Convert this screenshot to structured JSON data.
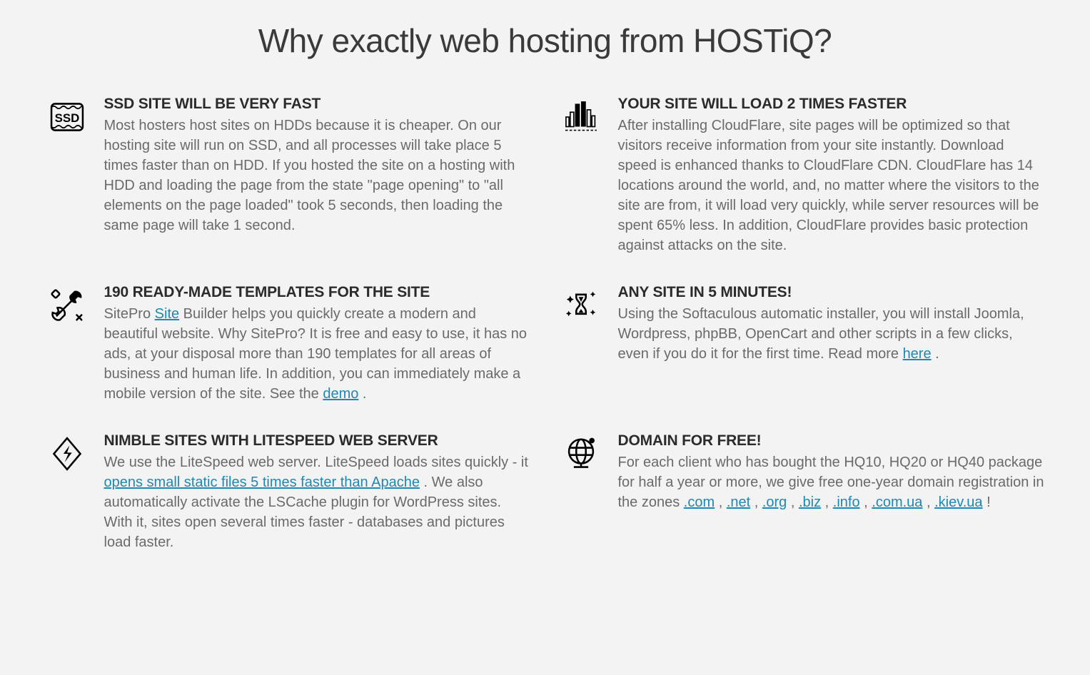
{
  "heading": "Why exactly web hosting from HOSTiQ?",
  "features": {
    "ssd": {
      "title": "SSD SITE WILL BE VERY FAST",
      "desc": "Most hosters host sites on HDDs because it is cheaper. On our hosting site will run on SSD, and all processes will take place 5 times faster than on HDD. If you hosted the site on a hosting with HDD and loading the page from the state \"page opening\" to \"all elements on the page loaded\" took 5 seconds, then loading the same page will take 1 second."
    },
    "cloudflare": {
      "title": "YOUR SITE WILL LOAD 2 TIMES FASTER",
      "desc": "After installing CloudFlare, site pages will be optimized so that visitors receive information from your site instantly. Download speed is enhanced thanks to CloudFlare CDN. CloudFlare has 14 locations around the world, and, no matter where the visitors to the site are from, it will load very quickly, while server resources will be spent 65% less. In addition, CloudFlare provides basic protection against attacks on the site."
    },
    "templates": {
      "title": "190 READY-MADE TEMPLATES FOR THE SITE",
      "pre": "SitePro ",
      "link1": "Site",
      "mid": " Builder helps you quickly create a modern and beautiful website. Why SitePro? It is free and easy to use, it has no ads, at your disposal more than 190 templates for all areas of business and human life. In addition, you can immediately make a mobile version of the site. See the ",
      "link2": "demo",
      "post": " ."
    },
    "softaculous": {
      "title": "ANY SITE IN 5 MINUTES!",
      "pre": "Using the Softaculous automatic installer, you will install Joomla, Wordpress, phpBB, OpenCart and other scripts in a few clicks, even if you do it for the first time. Read more ",
      "link": "here",
      "post": " ."
    },
    "litespeed": {
      "title": "NIMBLE SITES WITH LITESPEED WEB SERVER",
      "pre": "We use the LiteSpeed web server. LiteSpeed loads sites quickly - it ",
      "link": "opens small static files 5 times faster than Apache",
      "post": " . We also automatically activate the LSCache plugin for WordPress sites. With it, sites open several times faster - databases and pictures load faster."
    },
    "domain": {
      "title": "DOMAIN FOR FREE!",
      "pre": "For each client who has bought the HQ10, HQ20 or HQ40 package for half a year or more, we give free one-year domain registration in the zones ",
      "zones": [
        ".com",
        ".net",
        ".org",
        ".biz",
        ".info",
        ".com.ua",
        ".kiev.ua"
      ],
      "sep": " , ",
      "post": " !"
    }
  }
}
